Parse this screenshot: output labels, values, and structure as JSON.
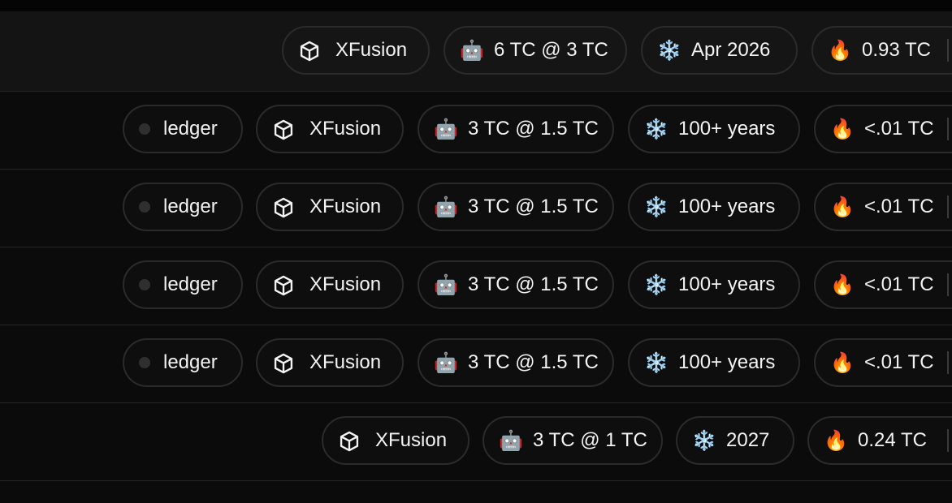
{
  "rows": [
    {
      "provider": "XFusion",
      "price": "6 TC @ 3 TC",
      "cutoff": "Apr 2026",
      "cost": "0.93 TC"
    },
    {
      "source": "ledger",
      "provider": "XFusion",
      "price": "3 TC @ 1.5 TC",
      "cutoff": "100+ years",
      "cost": "<.01 TC"
    },
    {
      "source": "ledger",
      "provider": "XFusion",
      "price": "3 TC @ 1.5 TC",
      "cutoff": "100+ years",
      "cost": "<.01 TC"
    },
    {
      "source": "ledger",
      "provider": "XFusion",
      "price": "3 TC @ 1.5 TC",
      "cutoff": "100+ years",
      "cost": "<.01 TC"
    },
    {
      "source": "ledger",
      "provider": "XFusion",
      "price": "3 TC @ 1.5 TC",
      "cutoff": "100+ years",
      "cost": "<.01 TC"
    },
    {
      "provider": "XFusion",
      "price": "3 TC @ 1 TC",
      "cutoff": "2027",
      "cost": "0.24 TC"
    }
  ],
  "icons": {
    "status": "status-dot-icon",
    "provider": "cube-icon",
    "price": "robot-emoji",
    "cutoff": "snowflake-emoji",
    "cost": "fire-emoji"
  },
  "glyphs": {
    "robot": "🤖",
    "snowflake": "❄️",
    "fire": "🔥"
  },
  "colors": {
    "background": "#0b0b0b",
    "header_row": "#141414",
    "pill_border": "#2b2b2b",
    "text": "#f3f3f3",
    "divider": "#242424",
    "status_dot": "#2f2f2f"
  }
}
